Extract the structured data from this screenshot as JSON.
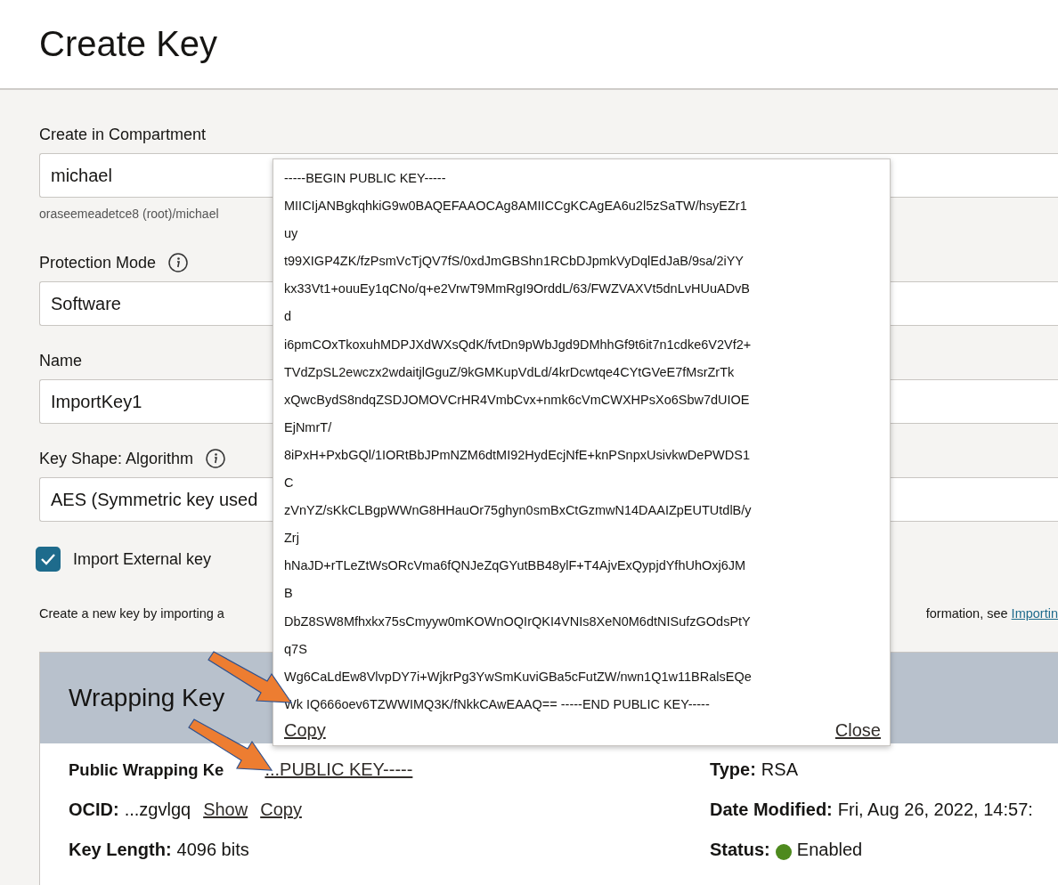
{
  "page": {
    "title": "Create Key"
  },
  "form": {
    "fields": [
      {
        "label": "Create in Compartment",
        "value": "michael",
        "hint": "oraseemeadetce8 (root)/michael",
        "info": false
      },
      {
        "label": "Protection Mode",
        "value": "Software",
        "info": true
      },
      {
        "label": "Name",
        "value": "ImportKey1",
        "info": false
      },
      {
        "label": "Key Shape: Algorithm",
        "value": "AES (Symmetric key used",
        "info": true
      }
    ],
    "import_checkbox": {
      "label": "Import External key",
      "checked": true
    },
    "description": {
      "text": "Create a new key by importing a",
      "text_after": "formation, see",
      "link": "Importin"
    }
  },
  "wrapping_key": {
    "title": "Wrapping Key",
    "public_key_label": "Public Wrapping Ke",
    "public_key_link": "...PUBLIC KEY-----",
    "ocid_label": "OCID:",
    "ocid_value": "...zgvlgq",
    "ocid_show": "Show",
    "ocid_copy": "Copy",
    "key_length_label": "Key Length:",
    "key_length_value": "4096 bits",
    "type_label": "Type:",
    "type_value": "RSA",
    "date_label": "Date Modified:",
    "date_value": "Fri, Aug 26, 2022, 14:57:",
    "status_label": "Status:",
    "status_value": "Enabled"
  },
  "popover": {
    "lines": [
      "-----BEGIN PUBLIC KEY-----",
      "MIICIjANBgkqhkiG9w0BAQEFAAOCAg8AMIICCgKCAgEA6u2l5zSaTW/hsyEZr1",
      "uy",
      "t99XIGP4ZK/fzPsmVcTjQV7fS/0xdJmGBShn1RCbDJpmkVyDqlEdJaB/9sa/2iYY",
      "kx33Vt1+ouuEy1qCNo/q+e2VrwT9MmRgI9OrddL/63/FWZVAXVt5dnLvHUuADvB",
      "d",
      "i6pmCOxTkoxuhMDPJXdWXsQdK/fvtDn9pWbJgd9DMhhGf9t6it7n1cdke6V2Vf2+",
      "TVdZpSL2ewczx2wdaitjlGguZ/9kGMKupVdLd/4krDcwtqe4CYtGVeE7fMsrZrTk",
      "xQwcBydS8ndqZSDJOMOVCrHR4VmbCvx+nmk6cVmCWXHPsXo6Sbw7dUIOE",
      "EjNmrT/",
      "8iPxH+PxbGQl/1IORtBbJPmNZM6dtMI92HydEcjNfE+knPSnpxUsivkwDePWDS1",
      "C",
      "zVnYZ/sKkCLBgpWWnG8HHauOr75ghyn0smBxCtGzmwN14DAAIZpEUTUtdlB/y",
      "Zrj",
      "hNaJD+rTLeZtWsORcVma6fQNJeZqGYutBB48ylF+T4AjvExQypjdYfhUhOxj6JM",
      "B",
      "DbZ8SW8Mfhxkx75sCmyyw0mKOWnOQIrQKI4VNIs8XeN0M6dtNISufzGOdsPtY",
      "q7S",
      "Wg6CaLdEw8VlvpDY7i+WjkrPg3YwSmKuviGBa5cFutZW/nwn1Q1w11BRalsEQe",
      "Wk IQ666oev6TZWWIMQ3K/fNkkCAwEAAQ== -----END PUBLIC KEY-----"
    ],
    "copy": "Copy",
    "close": "Close"
  }
}
